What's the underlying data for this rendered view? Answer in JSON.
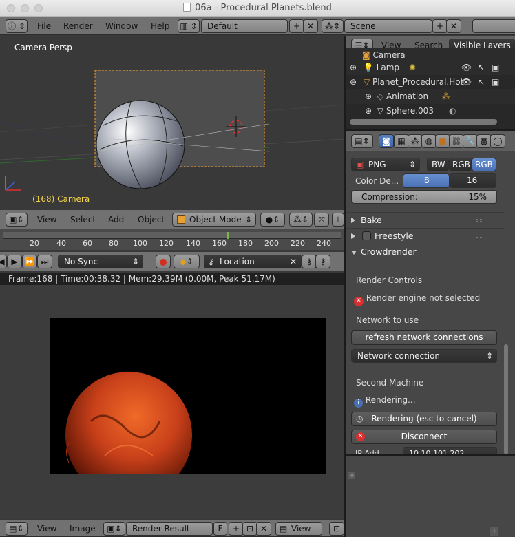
{
  "window": {
    "title": "06a - Procedural Planets.blend"
  },
  "info_header": {
    "menus": [
      "File",
      "Render",
      "Window",
      "Help"
    ],
    "layout": "Default",
    "scene": "Scene"
  },
  "viewport": {
    "label": "Camera Persp",
    "camera_label": "(168) Camera",
    "menus": [
      "View",
      "Select",
      "Add",
      "Object"
    ],
    "mode": "Object Mode"
  },
  "timeline": {
    "ticks": [
      "20",
      "40",
      "60",
      "80",
      "100",
      "120",
      "140",
      "160",
      "180",
      "200",
      "220",
      "240"
    ],
    "current_frame": 168,
    "sync": "No Sync",
    "keying_set": "Location"
  },
  "render_view": {
    "info": "Frame:168 | Time:00:38.32 | Mem:29.39M (0.00M, Peak 51.17M)",
    "menus": [
      "View",
      "Image"
    ],
    "image_name": "Render Result",
    "f_label": "F",
    "view_label": "View"
  },
  "outliner": {
    "menus": [
      "View",
      "Search"
    ],
    "filter": "Visible Layers",
    "items": [
      {
        "label": "Camera"
      },
      {
        "label": "Lamp"
      },
      {
        "label": "Planet_Procedural.Hot"
      },
      {
        "label": "Animation"
      },
      {
        "label": "Sphere.003"
      }
    ]
  },
  "properties": {
    "file_format": "PNG",
    "color_modes": [
      "BW",
      "RGB",
      "RGB"
    ],
    "color_depth_label": "Color De...",
    "color_depth_options": [
      "8",
      "16"
    ],
    "compression_label": "Compression:",
    "compression_value": "15%",
    "compression_fraction": 0.15,
    "sections": {
      "bake": "Bake",
      "freestyle": "Freestyle",
      "crowdrender": "Crowdrender"
    },
    "crowdrender": {
      "render_controls": "Render Controls",
      "engine_error": "Render engine not selected",
      "network_label": "Network to use",
      "refresh_button": "refresh network connections",
      "network_select": "Network connection",
      "second_machine": "Second Machine",
      "rendering_status": "Rendering...",
      "rendering_button": "Rendering (esc to cancel)",
      "disconnect_button": "Disconnect",
      "partial_left": "IP Add...",
      "partial_right": "10.10.101.202"
    }
  },
  "colors": {
    "accent_blue": "#5680c2",
    "error_red": "#e03030",
    "selection_orange": "#f0a030"
  }
}
